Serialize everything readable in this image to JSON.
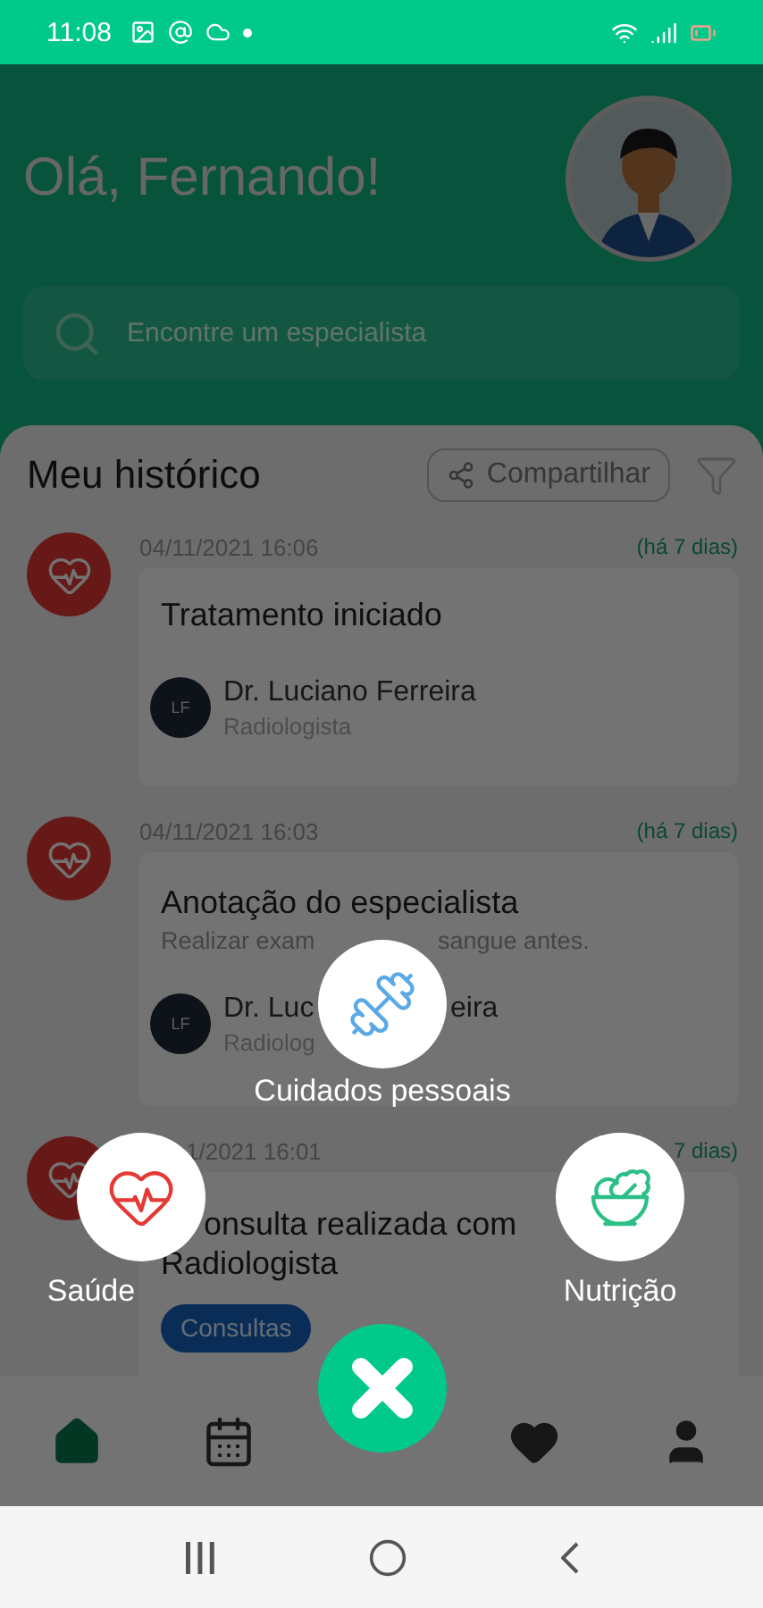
{
  "status_bar": {
    "time": "11:08"
  },
  "header": {
    "greeting": "Olá, Fernando!",
    "search": {
      "placeholder": "Encontre um especialista"
    }
  },
  "history": {
    "title": "Meu histórico",
    "share_button": "Compartilhar",
    "entries": [
      {
        "date": "04/11/2021 16:06",
        "relative": "(há 7 dias)",
        "title": "Tratamento iniciado",
        "doctor": {
          "initials": "LF",
          "name_parts": [
            "Dr. Luciano Ferreira"
          ],
          "specialty": "Radiologista"
        }
      },
      {
        "date": "04/11/2021 16:03",
        "relative": "(há 7 dias)",
        "title": "Anotação do especialista",
        "note_parts": [
          "Realizar exam",
          "sangue antes."
        ],
        "doctor": {
          "initials": "LF",
          "name_parts": [
            "Dr. Luc",
            "eira"
          ],
          "specialty": "Radiolog"
        }
      },
      {
        "date": "1/2021 16:01",
        "relative": "7 dias)",
        "title": "onsulta realizada com Radiologista",
        "tag": "Consultas"
      }
    ]
  },
  "quick_menu": {
    "open": true,
    "items": [
      {
        "kind": "care",
        "label": "Cuidados pessoais"
      },
      {
        "kind": "health",
        "label": "Saúde"
      },
      {
        "kind": "nutrition",
        "label": "Nutrição"
      }
    ]
  },
  "bottom_nav": [
    {
      "kind": "home",
      "selected": true
    },
    {
      "kind": "calendar",
      "selected": false
    },
    {
      "kind": "favorites",
      "selected": false
    },
    {
      "kind": "profile",
      "selected": false
    }
  ]
}
